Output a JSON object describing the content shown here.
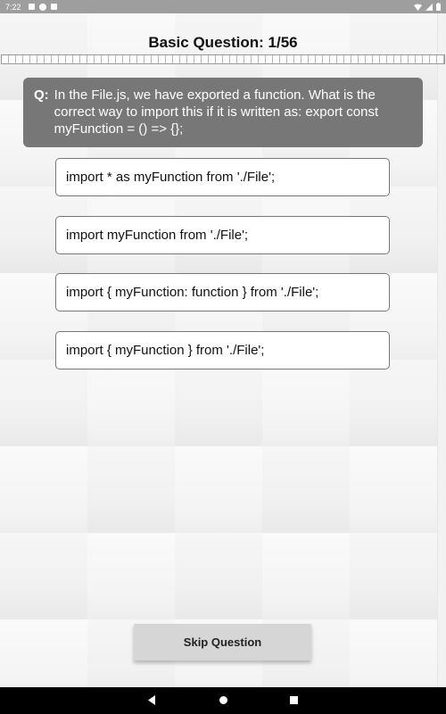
{
  "status_bar": {
    "time": "7:22"
  },
  "header": {
    "title": "Basic Question: 1/56"
  },
  "progress": {
    "current": 1,
    "total": 56
  },
  "question": {
    "prefix": "Q:",
    "text": "In the File.js, we have exported a function. What is the correct way to import this if it is written as: export const myFunction = () => {};"
  },
  "options": [
    {
      "label": "import * as myFunction from './File';"
    },
    {
      "label": "import myFunction from './File';"
    },
    {
      "label": "import { myFunction: function } from './File';"
    },
    {
      "label": "import { myFunction } from './File';"
    }
  ],
  "skip_button": {
    "label": "Skip Question"
  },
  "nav_bar": {
    "icons": [
      "back-icon",
      "home-icon",
      "recents-icon"
    ]
  }
}
